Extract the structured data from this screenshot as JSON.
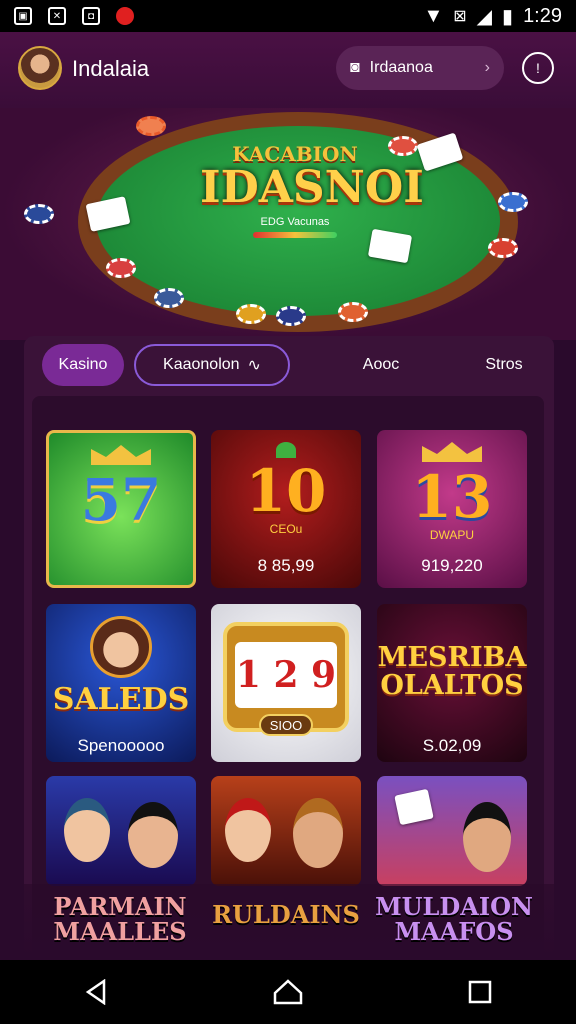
{
  "status_bar": {
    "time": "1:29"
  },
  "header": {
    "brand": "Indalaia",
    "pill_label": "Irdaanoa"
  },
  "hero": {
    "subtitle": "KACABION",
    "title": "IDASNOI",
    "tagline": "EDG Vacunas"
  },
  "tabs": [
    {
      "label": "Kasino"
    },
    {
      "label": "Kaaonolon"
    },
    {
      "label": "Aooc"
    },
    {
      "label": "Stros"
    }
  ],
  "tiles": [
    {
      "big": "57",
      "caption": "",
      "amount": ""
    },
    {
      "big": "10",
      "caption": "CEOu",
      "amount": "8 85,99"
    },
    {
      "big": "13",
      "caption": "DWAPU",
      "amount": "919,220"
    },
    {
      "big": "",
      "caption": "SALEDS",
      "amount": "Spenooooo"
    },
    {
      "big": "1 2 9",
      "caption": "SIOO",
      "amount": ""
    },
    {
      "big": "",
      "caption": "MESRIBA OLALTOS",
      "amount": "S.02,09"
    }
  ],
  "bottom_row": [
    {
      "label": "PARMAIN MAALLES"
    },
    {
      "label": "RULDAINS"
    },
    {
      "label": "MULDAION MAAFOS"
    }
  ],
  "colors": {
    "accent": "#7a2a96",
    "gold": "#f3c240",
    "bg": "#2a0a2c"
  }
}
